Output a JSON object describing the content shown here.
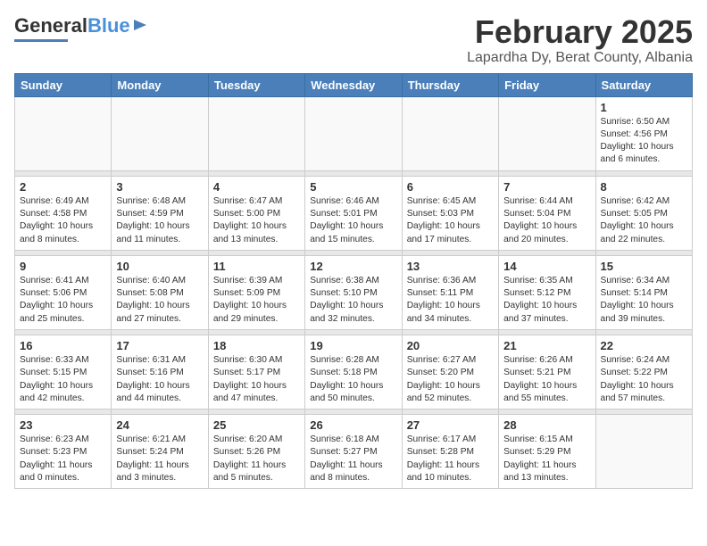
{
  "header": {
    "logo_general": "General",
    "logo_blue": "Blue",
    "title": "February 2025",
    "subtitle": "Lapardha Dy, Berat County, Albania"
  },
  "days_of_week": [
    "Sunday",
    "Monday",
    "Tuesday",
    "Wednesday",
    "Thursday",
    "Friday",
    "Saturday"
  ],
  "weeks": [
    [
      {
        "day": "",
        "info": ""
      },
      {
        "day": "",
        "info": ""
      },
      {
        "day": "",
        "info": ""
      },
      {
        "day": "",
        "info": ""
      },
      {
        "day": "",
        "info": ""
      },
      {
        "day": "",
        "info": ""
      },
      {
        "day": "1",
        "info": "Sunrise: 6:50 AM\nSunset: 4:56 PM\nDaylight: 10 hours\nand 6 minutes."
      }
    ],
    [
      {
        "day": "2",
        "info": "Sunrise: 6:49 AM\nSunset: 4:58 PM\nDaylight: 10 hours\nand 8 minutes."
      },
      {
        "day": "3",
        "info": "Sunrise: 6:48 AM\nSunset: 4:59 PM\nDaylight: 10 hours\nand 11 minutes."
      },
      {
        "day": "4",
        "info": "Sunrise: 6:47 AM\nSunset: 5:00 PM\nDaylight: 10 hours\nand 13 minutes."
      },
      {
        "day": "5",
        "info": "Sunrise: 6:46 AM\nSunset: 5:01 PM\nDaylight: 10 hours\nand 15 minutes."
      },
      {
        "day": "6",
        "info": "Sunrise: 6:45 AM\nSunset: 5:03 PM\nDaylight: 10 hours\nand 17 minutes."
      },
      {
        "day": "7",
        "info": "Sunrise: 6:44 AM\nSunset: 5:04 PM\nDaylight: 10 hours\nand 20 minutes."
      },
      {
        "day": "8",
        "info": "Sunrise: 6:42 AM\nSunset: 5:05 PM\nDaylight: 10 hours\nand 22 minutes."
      }
    ],
    [
      {
        "day": "9",
        "info": "Sunrise: 6:41 AM\nSunset: 5:06 PM\nDaylight: 10 hours\nand 25 minutes."
      },
      {
        "day": "10",
        "info": "Sunrise: 6:40 AM\nSunset: 5:08 PM\nDaylight: 10 hours\nand 27 minutes."
      },
      {
        "day": "11",
        "info": "Sunrise: 6:39 AM\nSunset: 5:09 PM\nDaylight: 10 hours\nand 29 minutes."
      },
      {
        "day": "12",
        "info": "Sunrise: 6:38 AM\nSunset: 5:10 PM\nDaylight: 10 hours\nand 32 minutes."
      },
      {
        "day": "13",
        "info": "Sunrise: 6:36 AM\nSunset: 5:11 PM\nDaylight: 10 hours\nand 34 minutes."
      },
      {
        "day": "14",
        "info": "Sunrise: 6:35 AM\nSunset: 5:12 PM\nDaylight: 10 hours\nand 37 minutes."
      },
      {
        "day": "15",
        "info": "Sunrise: 6:34 AM\nSunset: 5:14 PM\nDaylight: 10 hours\nand 39 minutes."
      }
    ],
    [
      {
        "day": "16",
        "info": "Sunrise: 6:33 AM\nSunset: 5:15 PM\nDaylight: 10 hours\nand 42 minutes."
      },
      {
        "day": "17",
        "info": "Sunrise: 6:31 AM\nSunset: 5:16 PM\nDaylight: 10 hours\nand 44 minutes."
      },
      {
        "day": "18",
        "info": "Sunrise: 6:30 AM\nSunset: 5:17 PM\nDaylight: 10 hours\nand 47 minutes."
      },
      {
        "day": "19",
        "info": "Sunrise: 6:28 AM\nSunset: 5:18 PM\nDaylight: 10 hours\nand 50 minutes."
      },
      {
        "day": "20",
        "info": "Sunrise: 6:27 AM\nSunset: 5:20 PM\nDaylight: 10 hours\nand 52 minutes."
      },
      {
        "day": "21",
        "info": "Sunrise: 6:26 AM\nSunset: 5:21 PM\nDaylight: 10 hours\nand 55 minutes."
      },
      {
        "day": "22",
        "info": "Sunrise: 6:24 AM\nSunset: 5:22 PM\nDaylight: 10 hours\nand 57 minutes."
      }
    ],
    [
      {
        "day": "23",
        "info": "Sunrise: 6:23 AM\nSunset: 5:23 PM\nDaylight: 11 hours\nand 0 minutes."
      },
      {
        "day": "24",
        "info": "Sunrise: 6:21 AM\nSunset: 5:24 PM\nDaylight: 11 hours\nand 3 minutes."
      },
      {
        "day": "25",
        "info": "Sunrise: 6:20 AM\nSunset: 5:26 PM\nDaylight: 11 hours\nand 5 minutes."
      },
      {
        "day": "26",
        "info": "Sunrise: 6:18 AM\nSunset: 5:27 PM\nDaylight: 11 hours\nand 8 minutes."
      },
      {
        "day": "27",
        "info": "Sunrise: 6:17 AM\nSunset: 5:28 PM\nDaylight: 11 hours\nand 10 minutes."
      },
      {
        "day": "28",
        "info": "Sunrise: 6:15 AM\nSunset: 5:29 PM\nDaylight: 11 hours\nand 13 minutes."
      },
      {
        "day": "",
        "info": ""
      }
    ]
  ]
}
